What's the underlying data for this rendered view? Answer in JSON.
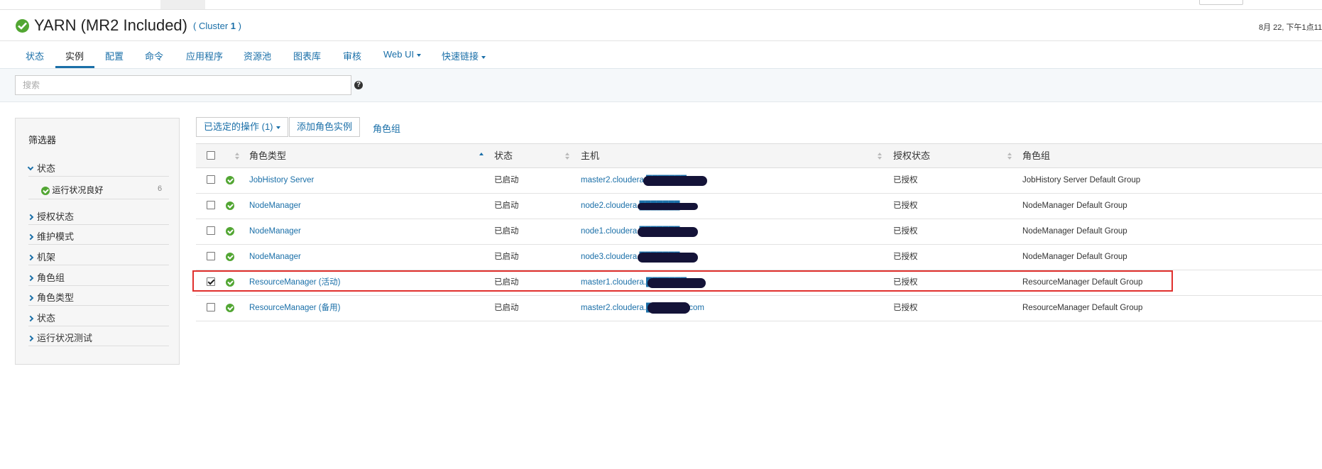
{
  "header": {
    "title": "YARN (MR2 Included)",
    "cluster_prefix": "(",
    "cluster_name": "Cluster",
    "cluster_num": "1",
    "cluster_suffix": ")",
    "time": "8月 22, 下午1点11"
  },
  "tabs": [
    {
      "label": "状态"
    },
    {
      "label": "实例",
      "active": true
    },
    {
      "label": "配置"
    },
    {
      "label": "命令"
    },
    {
      "label": "应用程序"
    },
    {
      "label": "资源池"
    },
    {
      "label": "图表库"
    },
    {
      "label": "审核"
    },
    {
      "label": "Web UI",
      "dropdown": true
    },
    {
      "label": "快速链接",
      "dropdown": true
    }
  ],
  "search": {
    "placeholder": "搜索",
    "value": ""
  },
  "filter": {
    "title": "筛选器",
    "status_expanded": "状态",
    "healthy_label": "运行状况良好",
    "healthy_count": "6",
    "groups": [
      "授权状态",
      "维护模式",
      "机架",
      "角色组",
      "角色类型",
      "状态",
      "运行状况测试"
    ]
  },
  "actions": {
    "selected_ops": "已选定的操作 (1)",
    "add_role": "添加角色实例",
    "role_groups": "角色组"
  },
  "table": {
    "headers": [
      "角色类型",
      "状态",
      "主机",
      "授权状态",
      "角色组"
    ],
    "rows": [
      {
        "checked": false,
        "role": "JobHistory Server",
        "status": "已启动",
        "host": "master2.cloudera.███████.com",
        "auth": "已授权",
        "group": "JobHistory Server Default Group"
      },
      {
        "checked": false,
        "role": "NodeManager",
        "status": "已启动",
        "host": "node2.cloudera.███████.com",
        "auth": "已授权",
        "group": "NodeManager Default Group"
      },
      {
        "checked": false,
        "role": "NodeManager",
        "status": "已启动",
        "host": "node1.cloudera.███████.com",
        "auth": "已授权",
        "group": "NodeManager Default Group"
      },
      {
        "checked": false,
        "role": "NodeManager",
        "status": "已启动",
        "host": "node3.cloudera.███████.com",
        "auth": "已授权",
        "group": "NodeManager Default Group"
      },
      {
        "checked": true,
        "role": "ResourceManager (活动)",
        "status": "已启动",
        "host": "master1.cloudera.███████.com",
        "auth": "已授权",
        "group": "ResourceManager Default Group"
      },
      {
        "checked": false,
        "role": "ResourceManager (备用)",
        "status": "已启动",
        "host": "master2.cloudera.███████.com",
        "auth": "已授权",
        "group": "ResourceManager Default Group"
      }
    ]
  },
  "colors": {
    "accent": "#1a6fa8",
    "ok": "#52a633",
    "highlight": "#e0302d"
  }
}
